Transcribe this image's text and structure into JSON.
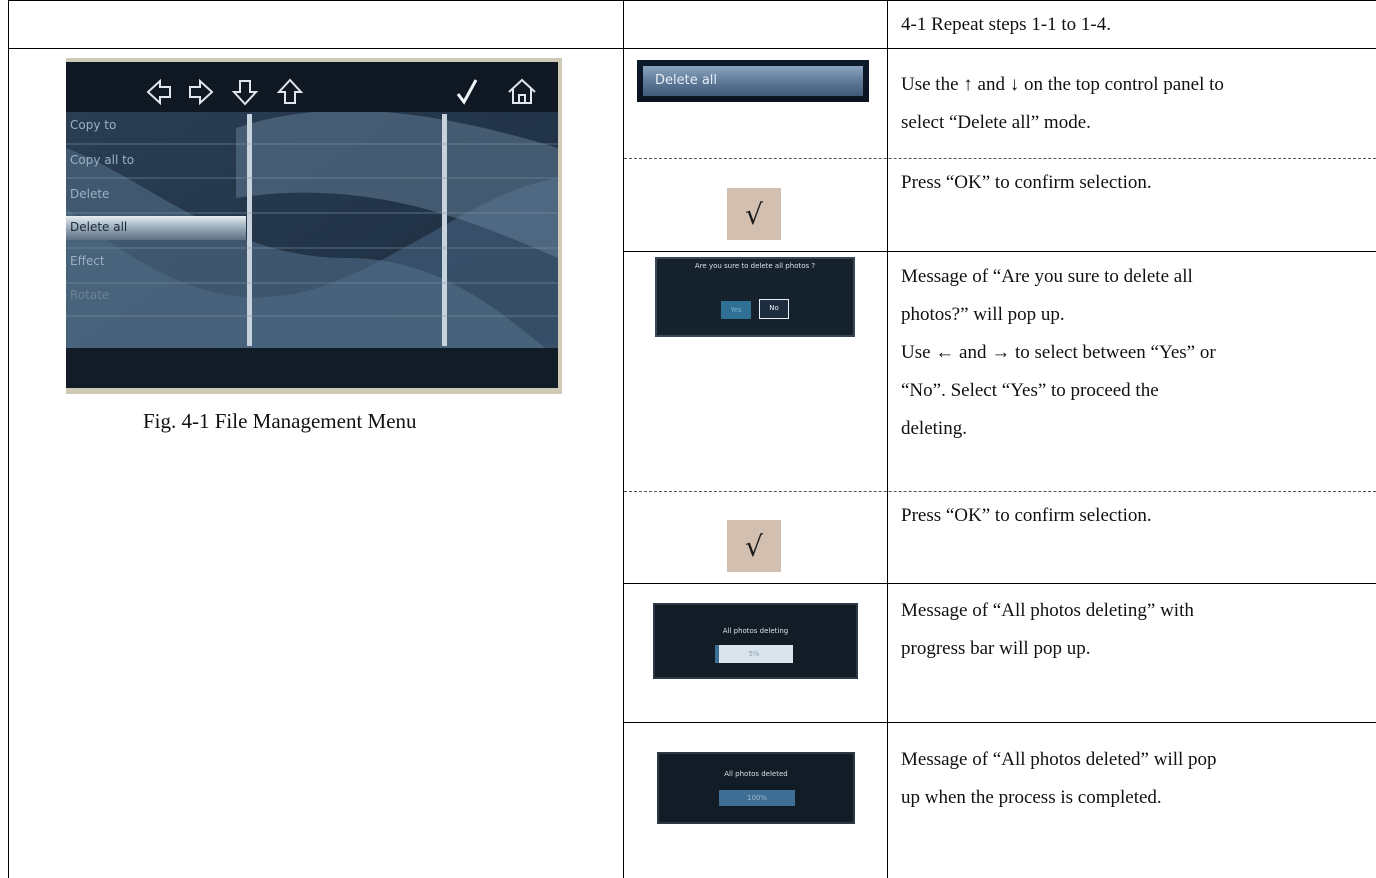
{
  "header_row": {
    "step_text": "4-1 Repeat steps 1-1 to 1-4."
  },
  "figure": {
    "caption": "Fig. 4-1 File Management Menu",
    "screen": {
      "toolbar_icons": [
        "left-arrow-icon",
        "right-arrow-icon",
        "down-arrow-icon",
        "up-arrow-icon",
        "checkmark-icon",
        "home-icon"
      ],
      "menu_items": [
        "Copy to",
        "Copy all to",
        "Delete",
        "Delete all",
        "Effect",
        "Rotate"
      ],
      "selected_item": "Delete all"
    }
  },
  "steps": [
    {
      "image": {
        "kind": "button",
        "label": "Delete all"
      },
      "lines": [
        "Use the ↑ and ↓ on the top control panel to",
        "select “Delete all” mode."
      ]
    },
    {
      "image": {
        "kind": "check",
        "glyph": "√"
      },
      "lines": [
        "Press “OK” to confirm selection."
      ]
    },
    {
      "image": {
        "kind": "dialog",
        "message": "Are you sure to delete all photos ?",
        "yes_label": "Yes",
        "no_label": "No"
      },
      "lines": [
        "Message of “Are you sure to delete all",
        "photos?” will pop up.",
        "Use ← and → to select between “Yes” or",
        "“No”. Select “Yes” to proceed the",
        "deleting."
      ]
    },
    {
      "image": {
        "kind": "check",
        "glyph": "√"
      },
      "lines": [
        "Press “OK” to confirm selection."
      ]
    },
    {
      "image": {
        "kind": "progress",
        "message": "All photos deleting",
        "percent_label": "5%",
        "progress": 0.05
      },
      "lines": [
        "Message of “All photos deleting” with",
        "progress bar will pop up."
      ]
    },
    {
      "image": {
        "kind": "progress",
        "message": "All photos deleted",
        "percent_label": "100%",
        "progress": 1.0
      },
      "lines": [
        "Message of “All photos deleted” will pop",
        "up when the process is completed."
      ]
    }
  ]
}
